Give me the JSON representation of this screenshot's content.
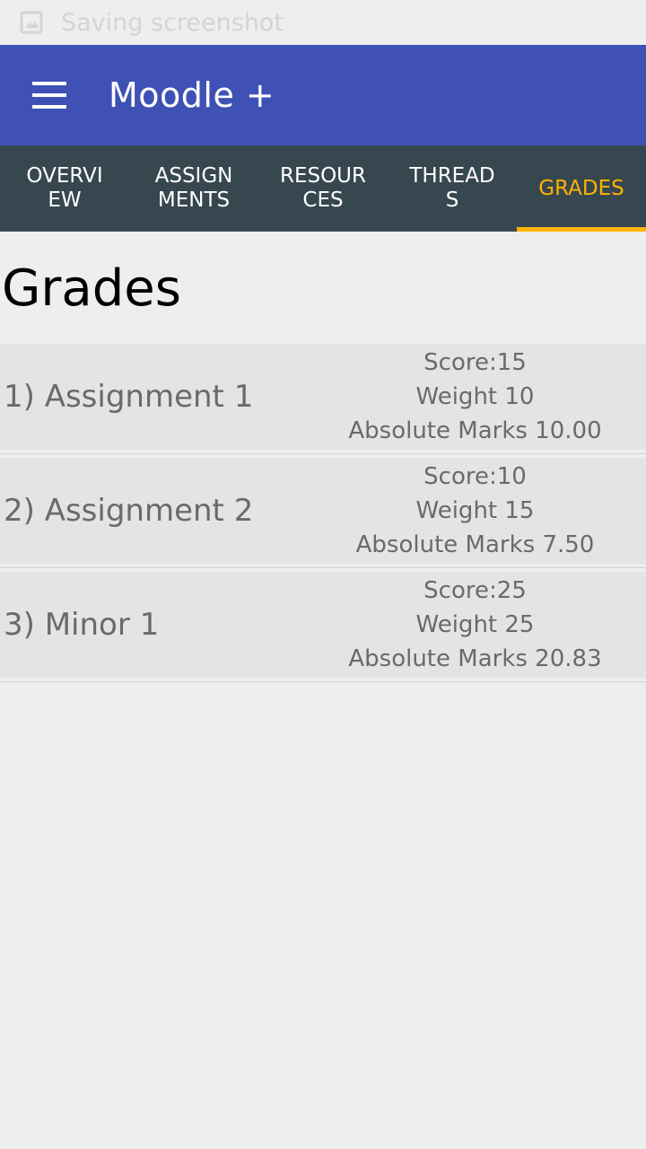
{
  "status_bar": {
    "text": "Saving screenshot",
    "icon": "image-icon"
  },
  "app_bar": {
    "title": "Moodle +",
    "menu_icon": "hamburger-menu-icon"
  },
  "tabs": [
    {
      "label": "OVERVI\nEW",
      "active": false
    },
    {
      "label": "ASSIGN\nMENTS",
      "active": false
    },
    {
      "label": "RESOUR\nCES",
      "active": false
    },
    {
      "label": "THREAD\nS",
      "active": false
    },
    {
      "label": "GRADES",
      "active": true
    }
  ],
  "page": {
    "title": "Grades"
  },
  "grades": [
    {
      "name": "1) Assignment 1",
      "score": "Score:15",
      "weight": "Weight 10",
      "absolute": "Absolute Marks 10.00"
    },
    {
      "name": "2) Assignment 2",
      "score": "Score:10",
      "weight": "Weight 15",
      "absolute": "Absolute Marks 7.50"
    },
    {
      "name": "3) Minor 1",
      "score": "Score:25",
      "weight": "Weight 25",
      "absolute": "Absolute Marks 20.83"
    }
  ],
  "colors": {
    "app_bar": "#3f51b5",
    "tab_bar": "#37474f",
    "active_tab": "#ffb300",
    "background": "#eeeeee",
    "row_background": "#e4e4e4"
  }
}
